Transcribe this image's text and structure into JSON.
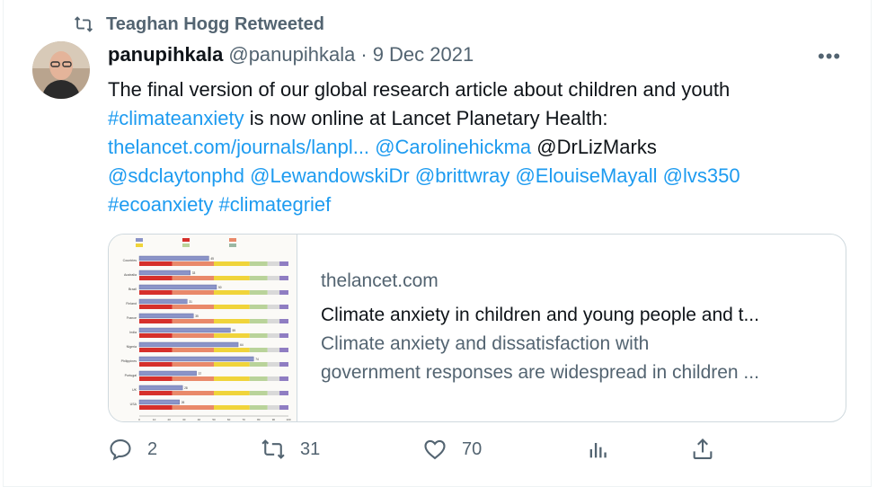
{
  "retweet": {
    "text": "Teaghan Hogg Retweeted"
  },
  "tweet": {
    "display_name": "panupihkala",
    "handle": "@panupihkala",
    "separator": "·",
    "date": "9 Dec 2021",
    "body": {
      "line1": "The final version of our global research article about children and youth",
      "line2_tag": "#climateanxiety",
      "line2_rest": " is now online at Lancet Planetary Health:",
      "line3_link": "thelancet.com/journals/lanpl...",
      "line3_mention1": "@Carolinehickma",
      "line3_mention2": "@DrLizMarks",
      "line4_m1": "@sdclaytonphd",
      "line4_m2": "@LewandowskiDr",
      "line4_m3": "@brittwray",
      "line4_m4": "@ElouiseMayall",
      "line4_m5": "@lvs350",
      "line5_t1": "#ecoanxiety",
      "line5_t2": "#climategrief"
    },
    "more_label": "•••",
    "card": {
      "domain": "thelancet.com",
      "title": "Climate anxiety in children and young people and t...",
      "desc_line1": "Climate anxiety and dissatisfaction with",
      "desc_line2": "government responses are widespread in children ..."
    },
    "actions": {
      "reply_count": "2",
      "retweet_count": "31",
      "like_count": "70"
    }
  },
  "colors": {
    "link": "#1d9bf0",
    "secondary_text": "#536471",
    "primary_text": "#0f1419",
    "border": "#cfd9de"
  },
  "icons": [
    "retweet-icon",
    "more-icon",
    "reply-icon",
    "like-icon",
    "analytics-icon",
    "share-icon"
  ],
  "thumbnail_chart": {
    "countries": [
      "Countries",
      "Australia",
      "Brazil",
      "Finland",
      "France",
      "India",
      "Nigeria",
      "Philippines",
      "Portugal",
      "UK",
      "USA"
    ],
    "impact_values": [
      45,
      33,
      50,
      31,
      35,
      59,
      64,
      74,
      37,
      28,
      26
    ],
    "xlabel": "Proportion of respondents (%)"
  }
}
